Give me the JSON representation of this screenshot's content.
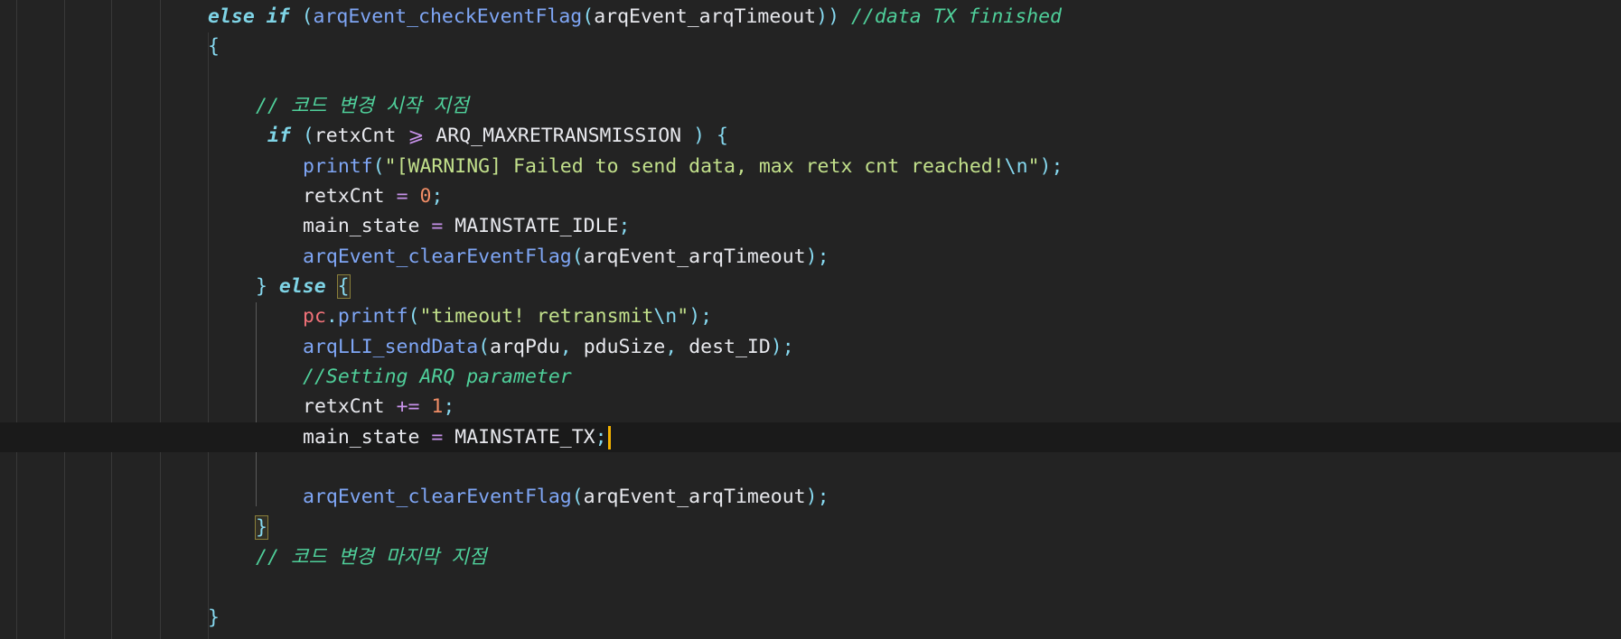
{
  "editor": {
    "lines": [
      {
        "id": "l1",
        "tokens": [
          {
            "t": "else",
            "c": "kw"
          },
          {
            "t": " ",
            "c": "var"
          },
          {
            "t": "if",
            "c": "kw"
          },
          {
            "t": " (",
            "c": "punc"
          },
          {
            "t": "arqEvent_checkEventFlag",
            "c": "fn"
          },
          {
            "t": "(",
            "c": "punc"
          },
          {
            "t": "arqEvent_arqTimeout",
            "c": "var"
          },
          {
            "t": ")) ",
            "c": "punc"
          },
          {
            "t": "//data TX finished",
            "c": "cmt"
          }
        ]
      },
      {
        "id": "l2",
        "tokens": [
          {
            "t": "{",
            "c": "punc"
          }
        ]
      },
      {
        "id": "l3",
        "tokens": []
      },
      {
        "id": "l4",
        "tokens": [
          {
            "t": "// 코드 변경 시작 지점",
            "c": "cmt"
          }
        ]
      },
      {
        "id": "l5",
        "tokens": [
          {
            "t": "if",
            "c": "kw"
          },
          {
            "t": " (",
            "c": "punc"
          },
          {
            "t": "retxCnt ",
            "c": "var"
          },
          {
            "t": "⩾",
            "c": "op"
          },
          {
            "t": " ARQ_MAXRETRANSMISSION ",
            "c": "const"
          },
          {
            "t": ") {",
            "c": "punc"
          }
        ]
      },
      {
        "id": "l6",
        "tokens": [
          {
            "t": "printf",
            "c": "fn"
          },
          {
            "t": "(",
            "c": "punc"
          },
          {
            "t": "\"[WARNING] Failed to send data, max retx cnt reached!",
            "c": "str"
          },
          {
            "t": "\\n",
            "c": "esc"
          },
          {
            "t": "\"",
            "c": "str"
          },
          {
            "t": ");",
            "c": "punc"
          }
        ]
      },
      {
        "id": "l7",
        "tokens": [
          {
            "t": "retxCnt ",
            "c": "var"
          },
          {
            "t": "=",
            "c": "op"
          },
          {
            "t": " ",
            "c": "var"
          },
          {
            "t": "0",
            "c": "num"
          },
          {
            "t": ";",
            "c": "punc"
          }
        ]
      },
      {
        "id": "l8",
        "tokens": [
          {
            "t": "main_state ",
            "c": "var"
          },
          {
            "t": "=",
            "c": "op"
          },
          {
            "t": " MAINSTATE_IDLE",
            "c": "const"
          },
          {
            "t": ";",
            "c": "punc"
          }
        ]
      },
      {
        "id": "l9",
        "tokens": [
          {
            "t": "arqEvent_clearEventFlag",
            "c": "fn"
          },
          {
            "t": "(",
            "c": "punc"
          },
          {
            "t": "arqEvent_arqTimeout",
            "c": "var"
          },
          {
            "t": ");",
            "c": "punc"
          }
        ]
      },
      {
        "id": "l10",
        "tokens": [
          {
            "t": "} ",
            "c": "punc"
          },
          {
            "t": "else",
            "c": "kw"
          },
          {
            "t": " ",
            "c": "var"
          },
          {
            "t": "{",
            "c": "punc",
            "hl": true
          }
        ]
      },
      {
        "id": "l11",
        "tokens": [
          {
            "t": "pc",
            "c": "obj"
          },
          {
            "t": ".",
            "c": "punc"
          },
          {
            "t": "printf",
            "c": "fn"
          },
          {
            "t": "(",
            "c": "punc"
          },
          {
            "t": "\"timeout! retransmit",
            "c": "str"
          },
          {
            "t": "\\n",
            "c": "esc"
          },
          {
            "t": "\"",
            "c": "str"
          },
          {
            "t": ");",
            "c": "punc"
          }
        ]
      },
      {
        "id": "l12",
        "tokens": [
          {
            "t": "arqLLI_sendData",
            "c": "fn"
          },
          {
            "t": "(",
            "c": "punc"
          },
          {
            "t": "arqPdu",
            "c": "var"
          },
          {
            "t": ", ",
            "c": "punc"
          },
          {
            "t": "pduSize",
            "c": "var"
          },
          {
            "t": ", ",
            "c": "punc"
          },
          {
            "t": "dest_ID",
            "c": "var"
          },
          {
            "t": ");",
            "c": "punc"
          }
        ]
      },
      {
        "id": "l13",
        "tokens": [
          {
            "t": "//Setting ARQ parameter",
            "c": "cmt"
          }
        ]
      },
      {
        "id": "l14",
        "tokens": [
          {
            "t": "retxCnt ",
            "c": "var"
          },
          {
            "t": "+=",
            "c": "op"
          },
          {
            "t": " ",
            "c": "var"
          },
          {
            "t": "1",
            "c": "num"
          },
          {
            "t": ";",
            "c": "punc"
          }
        ]
      },
      {
        "id": "l15",
        "tokens": [
          {
            "t": "main_state ",
            "c": "var"
          },
          {
            "t": "=",
            "c": "op"
          },
          {
            "t": " MAINSTATE_TX",
            "c": "const"
          },
          {
            "t": ";",
            "c": "punc"
          }
        ],
        "cursor": true
      },
      {
        "id": "l16",
        "tokens": []
      },
      {
        "id": "l17",
        "tokens": [
          {
            "t": "arqEvent_clearEventFlag",
            "c": "fn"
          },
          {
            "t": "(",
            "c": "punc"
          },
          {
            "t": "arqEvent_arqTimeout",
            "c": "var"
          },
          {
            "t": ");",
            "c": "punc"
          }
        ]
      },
      {
        "id": "l18",
        "tokens": [
          {
            "t": "}",
            "c": "punc",
            "hl": true
          }
        ]
      },
      {
        "id": "l19",
        "tokens": [
          {
            "t": "// 코드 변경 마지막 지점",
            "c": "cmt"
          }
        ]
      },
      {
        "id": "l20",
        "tokens": []
      },
      {
        "id": "l21",
        "tokens": [
          {
            "t": "}",
            "c": "punc"
          }
        ]
      }
    ]
  }
}
